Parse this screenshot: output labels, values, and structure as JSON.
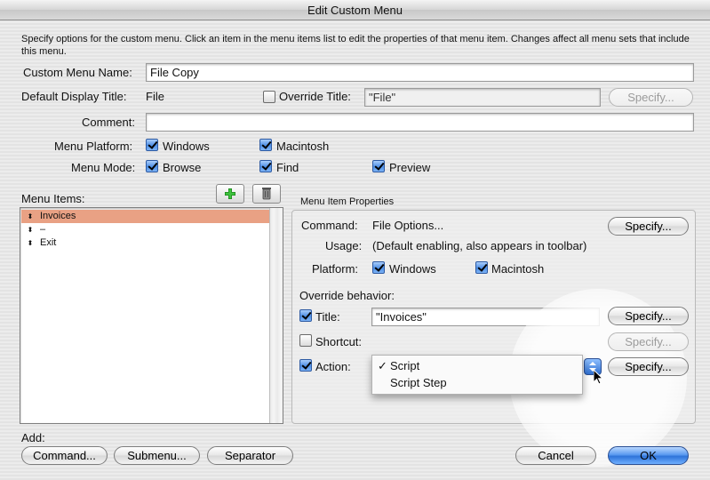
{
  "window": {
    "title": "Edit Custom Menu"
  },
  "description": "Specify options for the custom menu. Click an item in the menu items list to edit the properties of that menu item. Changes affect all menu sets that include this menu.",
  "menu_name": {
    "label": "Custom Menu Name:",
    "value": "File Copy"
  },
  "default_display": {
    "label": "Default Display Title:",
    "value": "File"
  },
  "override_title": {
    "label": "Override Title:",
    "checked": false,
    "value": "\"File\"",
    "specify_label": "Specify..."
  },
  "comment": {
    "label": "Comment:",
    "value": ""
  },
  "platform": {
    "label": "Menu Platform:",
    "windows": "Windows",
    "macintosh": "Macintosh"
  },
  "mode": {
    "label": "Menu Mode:",
    "browse": "Browse",
    "find": "Find",
    "preview": "Preview"
  },
  "menu_items": {
    "label": "Menu Items:",
    "add_icon": "plus-icon",
    "delete_icon": "trash-icon",
    "items": [
      {
        "label": "Invoices",
        "selected": true
      },
      {
        "label": "–",
        "selected": false
      },
      {
        "label": "Exit",
        "selected": false
      }
    ]
  },
  "properties": {
    "header": "Menu Item Properties",
    "command_label": "Command:",
    "command_value": "File Options...",
    "command_specify": "Specify...",
    "usage_label": "Usage:",
    "usage_value": "(Default enabling, also appears in toolbar)",
    "platform_label": "Platform:",
    "platform_windows": "Windows",
    "platform_macintosh": "Macintosh",
    "override_label": "Override behavior:",
    "title_label": "Title:",
    "title_value": "\"Invoices\"",
    "title_specify": "Specify...",
    "shortcut_label": "Shortcut:",
    "shortcut_specify": "Specify...",
    "action_label": "Action:",
    "action_specify": "Specify..."
  },
  "action_menu": {
    "options": [
      "Script",
      "Script Step"
    ],
    "checked_mark": "✓"
  },
  "footer": {
    "add_label": "Add:",
    "command_btn": "Command...",
    "submenu_btn": "Submenu...",
    "separator_btn": "Separator",
    "cancel_btn": "Cancel",
    "ok_btn": "OK"
  }
}
